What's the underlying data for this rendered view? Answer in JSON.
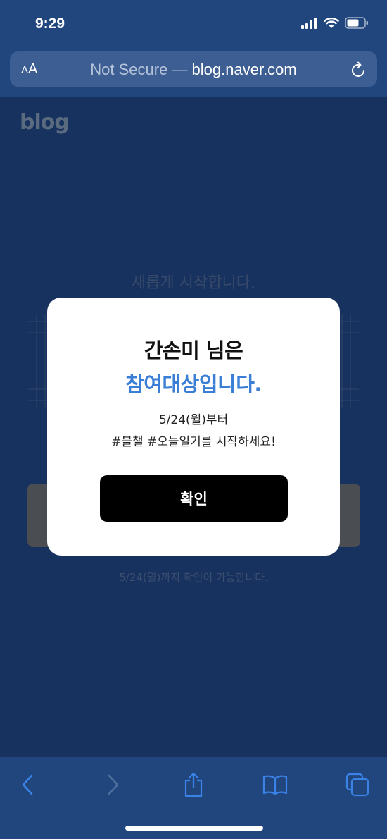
{
  "status_bar": {
    "time": "9:29"
  },
  "browser": {
    "aa_label_small": "A",
    "aa_label_large": "A",
    "security_label": "Not Secure",
    "separator": " — ",
    "domain": "blog.naver.com"
  },
  "page": {
    "logo": "blog",
    "headline": "새롭게 시작합니다.",
    "note": "5/24(월)까지 확인이 가능합니다."
  },
  "modal": {
    "title": "간손미 님은",
    "subtitle": "참여대상입니다.",
    "line1": "5/24(월)부터",
    "line2": "#블챌 #오늘일기를 시작하세요!",
    "confirm_label": "확인"
  },
  "colors": {
    "accent_blue": "#3a7fd5",
    "browser_chrome": "#21467e",
    "page_overlay": "#17325e"
  },
  "toolbar": {
    "icons": [
      "back-icon",
      "forward-icon",
      "share-icon",
      "bookmarks-icon",
      "tabs-icon"
    ]
  }
}
